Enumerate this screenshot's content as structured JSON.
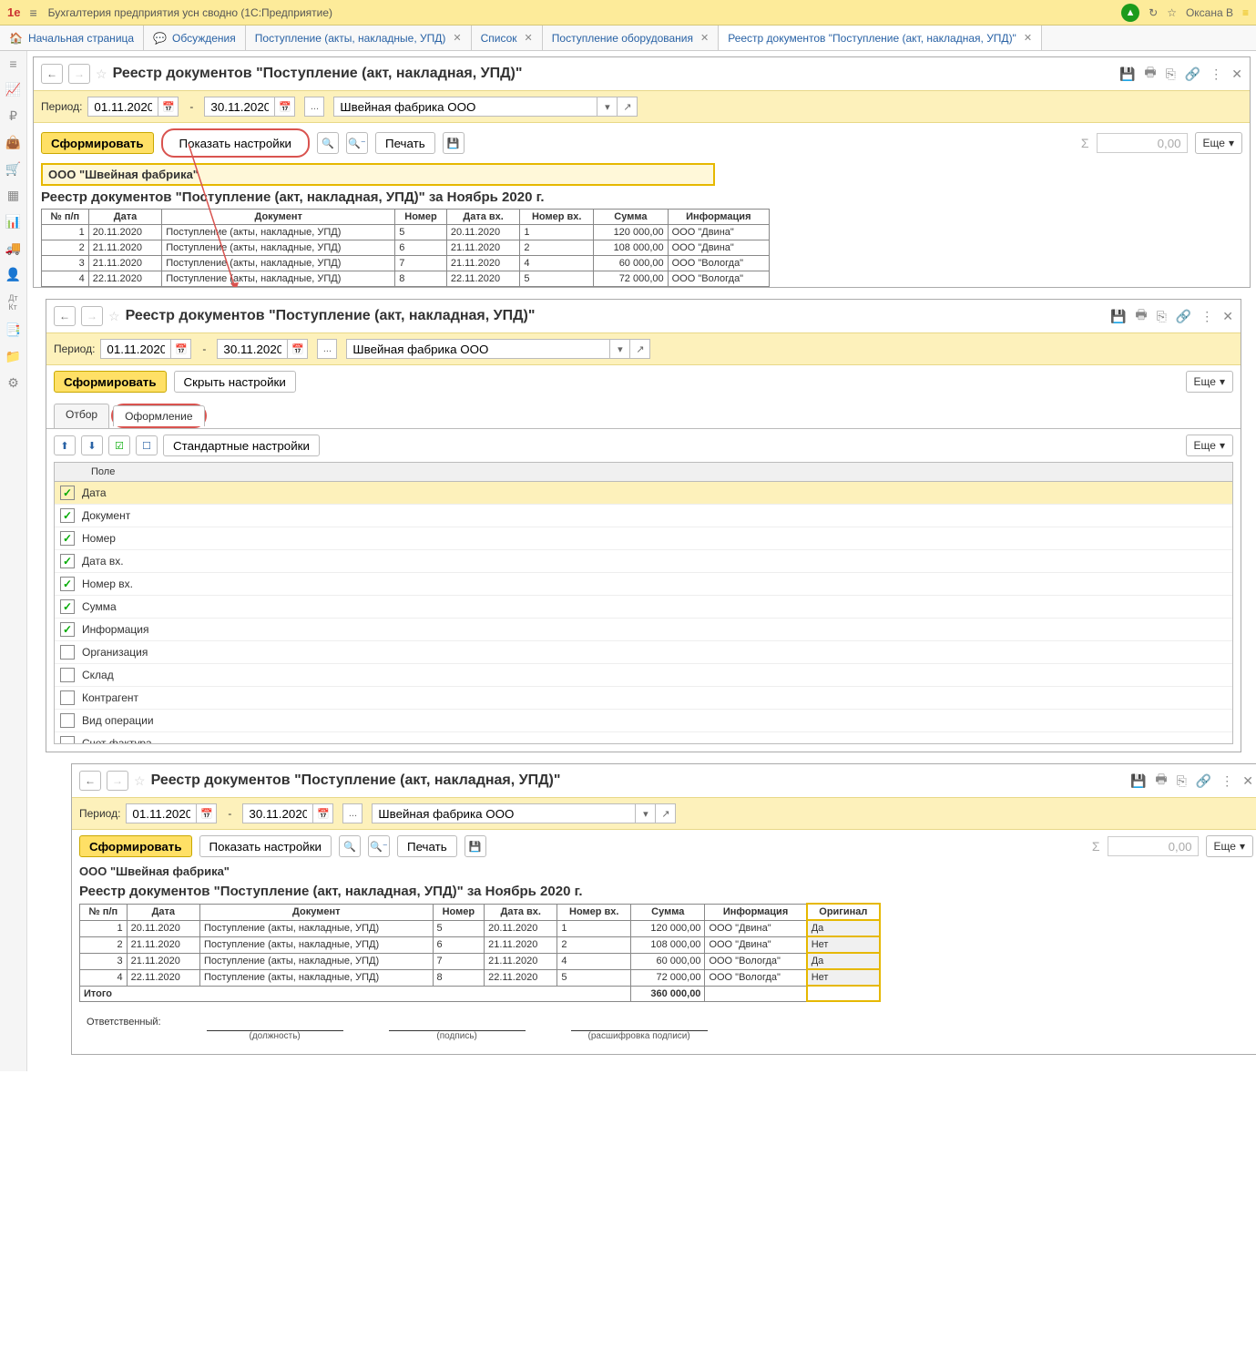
{
  "app": {
    "logo": "1e",
    "title": "Бухгалтерия предприятия усн сводно  (1С:Предприятие)",
    "user": "Оксана В"
  },
  "tabs": [
    {
      "label": "Начальная страница",
      "icon": "🏠"
    },
    {
      "label": "Обсуждения",
      "icon": "💬"
    },
    {
      "label": "Поступление (акты, накладные, УПД)"
    },
    {
      "label": "Список"
    },
    {
      "label": "Поступление оборудования"
    },
    {
      "label": "Реестр документов \"Поступление (акт, накладная, УПД)\"",
      "active": true
    }
  ],
  "panel": {
    "title": "Реестр документов \"Поступление (акт, накладная, УПД)\"",
    "period_label": "Период:",
    "date_from": "01.11.2020",
    "date_to": "30.11.2020",
    "dots": "...",
    "org": "Швейная фабрика ООО",
    "generate": "Сформировать",
    "show_settings": "Показать настройки",
    "hide_settings": "Скрыть настройки",
    "print": "Печать",
    "more": "Еще",
    "sum_placeholder": "0,00",
    "std_settings": "Стандартные настройки"
  },
  "report": {
    "org_head": "ООО \"Швейная фабрика\"",
    "title": "Реестр документов \"Поступление (акт, накладная, УПД)\" за Ноябрь 2020 г.",
    "columns": [
      "№ п/п",
      "Дата",
      "Документ",
      "Номер",
      "Дата вх.",
      "Номер вх.",
      "Сумма",
      "Информация"
    ],
    "rows": [
      {
        "n": "1",
        "d": "20.11.2020",
        "doc": "Поступление (акты, накладные, УПД)",
        "num": "5",
        "dvh": "20.11.2020",
        "nvh": "1",
        "sum": "120 000,00",
        "info": "ООО \"Двина\""
      },
      {
        "n": "2",
        "d": "21.11.2020",
        "doc": "Поступление (акты, накладные, УПД)",
        "num": "6",
        "dvh": "21.11.2020",
        "nvh": "2",
        "sum": "108 000,00",
        "info": "ООО \"Двина\""
      },
      {
        "n": "3",
        "d": "21.11.2020",
        "doc": "Поступление (акты, накладные, УПД)",
        "num": "7",
        "dvh": "21.11.2020",
        "nvh": "4",
        "sum": "60 000,00",
        "info": "ООО \"Вологда\""
      },
      {
        "n": "4",
        "d": "22.11.2020",
        "doc": "Поступление (акты, накладные, УПД)",
        "num": "8",
        "dvh": "22.11.2020",
        "nvh": "5",
        "sum": "72 000,00",
        "info": "ООО \"Вологда\""
      }
    ]
  },
  "design": {
    "tab_filter": "Отбор",
    "tab_design": "Оформление",
    "field_col": "Поле",
    "items": [
      {
        "label": "Дата",
        "on": true,
        "sel": true
      },
      {
        "label": "Документ",
        "on": true
      },
      {
        "label": "Номер",
        "on": true
      },
      {
        "label": "Дата вх.",
        "on": true
      },
      {
        "label": "Номер вх.",
        "on": true
      },
      {
        "label": "Сумма",
        "on": true
      },
      {
        "label": "Информация",
        "on": true
      },
      {
        "label": "Организация",
        "on": false
      },
      {
        "label": "Склад",
        "on": false
      },
      {
        "label": "Контрагент",
        "on": false
      },
      {
        "label": "Вид операции",
        "on": false
      },
      {
        "label": "Счет фактура",
        "on": false
      },
      {
        "label": "Оригинал",
        "on": true,
        "sel": true,
        "red": true
      }
    ]
  },
  "report2": {
    "extra_col": "Оригинал",
    "orig": [
      "Да",
      "Нет",
      "Да",
      "Нет"
    ],
    "total_label": "Итого",
    "total_sum": "360 000,00",
    "resp": "Ответственный:",
    "sig1": "(должность)",
    "sig2": "(подпись)",
    "sig3": "(расшифровка подписи)"
  }
}
